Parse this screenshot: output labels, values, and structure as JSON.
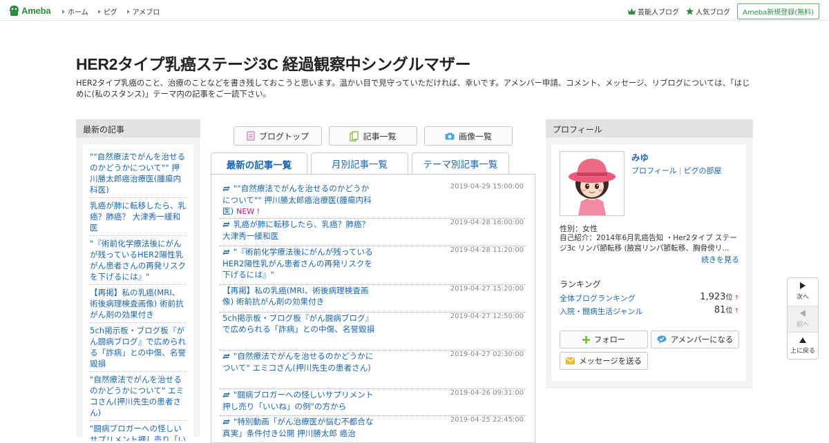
{
  "topbar": {
    "logo_text": "Ameba",
    "nav": [
      "ホーム",
      "ピグ",
      "アメブロ"
    ],
    "celeb_blog": "芸能人ブログ",
    "popular_blog": "人気ブログ",
    "register": "Ameba新規登録(無料)"
  },
  "blog": {
    "title": "HER2タイプ乳癌ステージ3C 経過観察中シングルマザー",
    "description": "HER2タイプ乳癌のこと、治療のことなどを書き残しておこうと思います。温かい目で見守っていただければ、幸いです。アメンバー申請、コメント、メッセージ、リブログについては、「はじめに(私のスタンス)」テーマ内の記事をご一読下さい。"
  },
  "left": {
    "heading": "最新の記事",
    "items": [
      "\"\"自然療法でがんを治せるのかどうかについて\"\" 押川勝太郎癌治療医(腫瘍内科医)",
      "乳癌が肺に転移したら、乳癌？肺癌？ 大津秀一緩和医",
      "\"『術前化学療法後にがんが残っているHER2陽性乳がん患者さんの再発リスクを下げるには』\"",
      "【再掲】私の乳癌(MRI、術後病理検査画像) 術前抗がん剤の効果付き",
      "5ch掲示板・ブログ板『がん闘病ブログ』で広められる「詐病」との中傷、名誉毀損",
      "\"自然療法でがんを治せるのかどうかについて\" エミコさん(押川先生の患者さん)",
      "\"闘病ブロガーへの怪しいサプリメント押し売り「いいね」の例\"の方から"
    ]
  },
  "center": {
    "buttons": [
      "ブログトップ",
      "記事一覧",
      "画像一覧"
    ],
    "tabs": [
      "最新の記事一覧",
      "月別記事一覧",
      "テーマ別記事一覧"
    ],
    "new_label": "NEW !",
    "articles": [
      {
        "title": "\"\"自然療法でがんを治せるのかどうかについて\"\" 押川勝太郎癌治療医(腫瘍内科医)",
        "date": "2019-04-29 15:00:00",
        "reblog": true,
        "is_new": true
      },
      {
        "title": "乳癌が肺に転移したら、乳癌？肺癌？ 大津秀一緩和医",
        "date": "2019-04-28 16:00:00",
        "reblog": true,
        "is_new": false
      },
      {
        "title": "\"『術前化学療法後にがんが残っているHER2陽性乳がん患者さんの再発リスクを下げるには』\"",
        "date": "2019-04-28 11:20:00",
        "reblog": true,
        "is_new": false
      },
      {
        "title": "【再掲】私の乳癌(MRI、術後病理検査画像) 術前抗がん剤の効果付き",
        "date": "2019-04-27 15:20:00",
        "reblog": false,
        "is_new": false
      },
      {
        "title": "5ch掲示板・ブログ板『がん闘病ブログ』で広められる「詐病」との中傷、名誉毀損",
        "date": "2019-04-27 12:50:00",
        "reblog": false,
        "is_new": false
      },
      {
        "title": "\"自然療法でがんを治せるのかどうかについて\" エミコさん(押川先生の患者さん)",
        "date": "2019-04-27 02:30:00",
        "reblog": true,
        "is_new": false
      },
      {
        "title": "\"闘病ブロガーへの怪しいサプリメント押し売り「いいね」の例\"の方から",
        "date": "2019-04-26 09:31:00",
        "reblog": true,
        "is_new": false
      },
      {
        "title": "\"特別動画「がん治療医が悩む不都合な真実」条件付き公開 押川勝太郎 癌治",
        "date": "2019-04-25 22:45:00",
        "reblog": true,
        "is_new": false
      }
    ]
  },
  "profile": {
    "heading": "プロフィール",
    "name": "みゆ",
    "link_profile": "プロフィール",
    "link_pig": "ピグの部屋",
    "gender": "性別：女性",
    "intro": "自己紹介：2014年6月乳癌告知 ・Her2タイプ ステージ3c リンパ節転移 (腋窩リンパ節転移、胸骨傍リ...",
    "more": "続きを見る",
    "ranking_heading": "ランキング",
    "rankings": [
      {
        "label": "全体ブログランキング",
        "value": "1,923",
        "unit": "位",
        "trend": "↑"
      },
      {
        "label": "入院・闘病生活ジャンル",
        "value": "81",
        "unit": "位",
        "trend": "↑"
      }
    ],
    "follow": "フォロー",
    "amember": "アメンバーになる",
    "message": "メッセージを送る"
  },
  "side_nav": {
    "next": "次へ",
    "prev": "前へ",
    "top": "上に戻る"
  }
}
